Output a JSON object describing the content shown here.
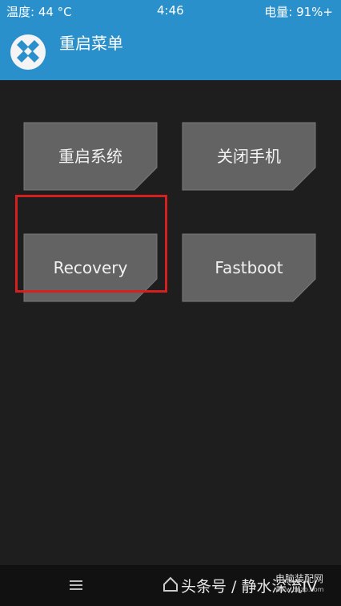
{
  "status_bar": {
    "temperature": "温度: 44 °C",
    "time": "4:46",
    "battery": "电量: 91%+"
  },
  "header": {
    "title": "重启菜单",
    "logo_icon": "twrp-logo-icon"
  },
  "buttons": {
    "reboot_system": "重启系统",
    "power_off": "关闭手机",
    "recovery": "Recovery",
    "fastboot": "Fastboot"
  },
  "colors": {
    "accent": "#2a90cb",
    "tile": "#636363",
    "highlight": "#d61f1f"
  },
  "nav_bar": {
    "watermark": "头条号 / 静水深流ⅠⅤ",
    "site_name": "电脑装配网",
    "site_url": "www.dnzp.com"
  }
}
